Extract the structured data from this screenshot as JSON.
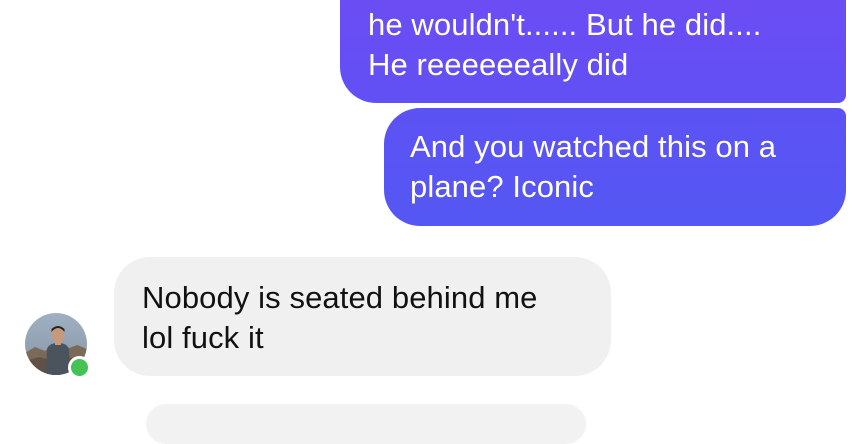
{
  "thread": {
    "messages": [
      {
        "sender": "me",
        "text": "he wouldn't...... But he did....\nHe reeeeeeally did"
      },
      {
        "sender": "me",
        "text": "And you watched this on a\nplane? Iconic"
      },
      {
        "sender": "contact",
        "text": "Nobody is seated behind me\nlol fuck it"
      }
    ]
  },
  "colors": {
    "outgoing_bubble_top": "#6f4cf3",
    "outgoing_bubble_bottom": "#5457f3",
    "incoming_bubble": "#f0f0f0",
    "presence_online": "#44c256"
  },
  "contact": {
    "avatar_icon": "profile-photo",
    "status": "online"
  }
}
